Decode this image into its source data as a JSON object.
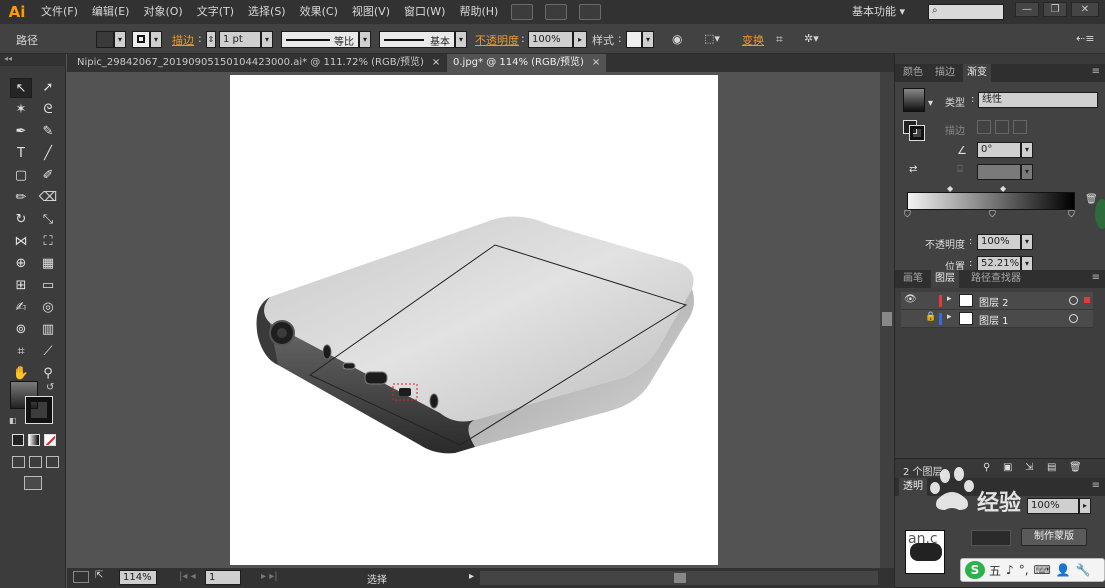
{
  "app": {
    "logo": "Ai",
    "menus": [
      "文件(F)",
      "编辑(E)",
      "对象(O)",
      "文字(T)",
      "选择(S)",
      "效果(C)",
      "视图(V)",
      "窗口(W)",
      "帮助(H)"
    ],
    "workspace_label": "基本功能",
    "workspace_caret": "▾",
    "search_placeholder": ""
  },
  "window_controls": {
    "minimize": "—",
    "restore": "❐",
    "close": "✕"
  },
  "control_bar": {
    "object_type": "路径",
    "stroke_label": "描边",
    "stroke_weight": "1 pt",
    "profile_label": "等比",
    "brush_label": "基本",
    "opacity_label": "不透明度",
    "opacity_value": "100%",
    "style_label": "样式",
    "transform_label": "变换"
  },
  "tabs": [
    {
      "title": "Nipic_29842067_20190905150104423000.ai* @ 111.72% (RGB/预览)",
      "close": "×",
      "active": false
    },
    {
      "title": "0.jpg* @ 114% (RGB/预览)",
      "close": "×",
      "active": true
    }
  ],
  "tools": {
    "selection": "selection-icon",
    "direct_selection": "direct-selection-icon"
  },
  "gradient_panel": {
    "tabs": [
      "颜色",
      "描边",
      "渐变"
    ],
    "active_tab": "渐变",
    "type_label": "类型",
    "type_value": "线性",
    "stroke_label": "描边",
    "angle_value": "0°",
    "opacity_label": "不透明度",
    "opacity_value": "100%",
    "location_label": "位置",
    "location_value": "52.21%",
    "gradient_start_color": "#f2f2f2",
    "gradient_end_color": "#000000"
  },
  "layers_panel": {
    "tabs": [
      "画笔",
      "图层",
      "路径查找器"
    ],
    "active_tab": "图层",
    "layers": [
      {
        "name": "图层 2",
        "color": "#e23a3a",
        "visible": true,
        "locked": false
      },
      {
        "name": "图层 1",
        "color": "#3a6ae2",
        "visible": false,
        "locked": true
      }
    ],
    "count_label": "2 个图层"
  },
  "transparency_panel": {
    "title": "透明",
    "opacity_value": "100%",
    "make_mask_button": "制作蒙版"
  },
  "status_bar": {
    "zoom": "114%",
    "artboard_number": "1",
    "tool_status": "选择"
  },
  "ime_bar": {
    "logo": "S",
    "labels": [
      "五",
      "♪",
      "°,",
      "⌨",
      "👤",
      "🔧"
    ]
  },
  "watermark_text": "an.c"
}
